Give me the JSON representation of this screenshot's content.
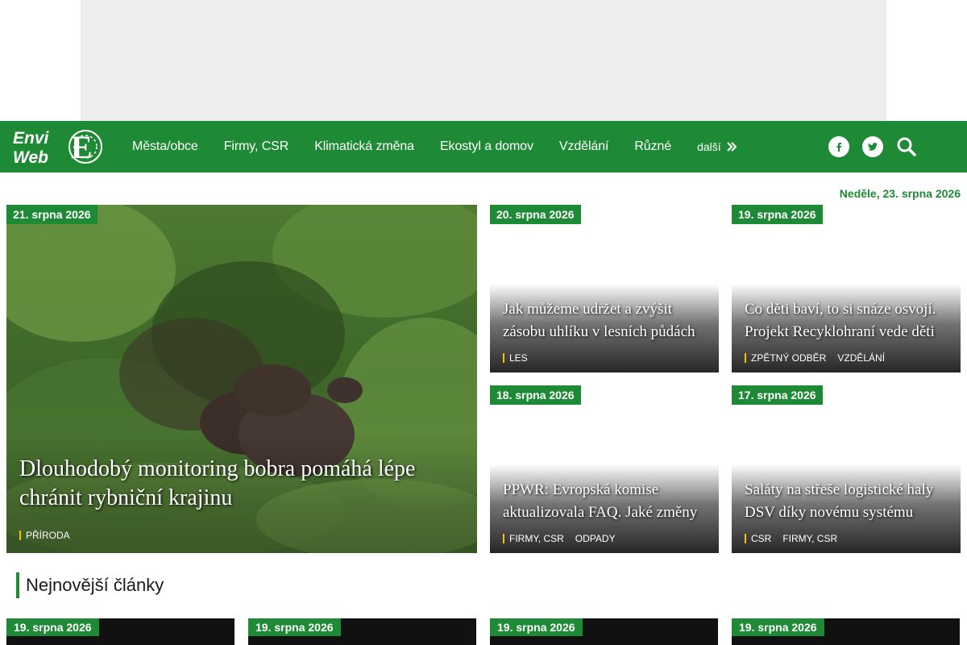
{
  "nav": {
    "logo_text": "EnviWeb",
    "items": [
      "Města/obce",
      "Firmy, CSR",
      "Klimatická změna",
      "Ekostyl a domov",
      "Vzdělání",
      "Různé"
    ],
    "more_label": "další"
  },
  "current_date": "Neděle, 23. srpna 2026",
  "featured": {
    "date": "21. srpna 2026",
    "title": "Dlouhodobý monitoring bobra pomáhá lépe chránit rybniční krajinu",
    "tags": [
      "PŘÍRODA"
    ]
  },
  "cards": [
    {
      "date": "20. srpna 2026",
      "title": "Jak můžeme udržet a zvýšit zásobu uhlíku v lesních půdách",
      "tags": [
        "LES"
      ]
    },
    {
      "date": "19. srpna 2026",
      "title": "Co děti baví, to si snáze osvojí. Projekt Recyklohraní vede děti",
      "tags": [
        "ZPĚTNÝ ODBĚR",
        "VZDĚLÁNÍ"
      ]
    },
    {
      "date": "18. srpna 2026",
      "title": "PPWR: Evropská komise aktualizovala FAQ. Jaké změny",
      "tags": [
        "FIRMY, CSR",
        "ODPADY"
      ]
    },
    {
      "date": "17. srpna 2026",
      "title": "Saláty na střeše logistické haly DSV díky novému systému",
      "tags": [
        "CSR",
        "FIRMY, CSR"
      ]
    }
  ],
  "latest": {
    "heading": "Nejnovější články",
    "items": [
      {
        "date": "19. srpna 2026"
      },
      {
        "date": "19. srpna 2026"
      },
      {
        "date": "19. srpna 2026"
      },
      {
        "date": "19. srpna 2026"
      }
    ]
  },
  "colors": {
    "brand_green": "#1e8a36",
    "tag_accent": "#f2c400"
  }
}
